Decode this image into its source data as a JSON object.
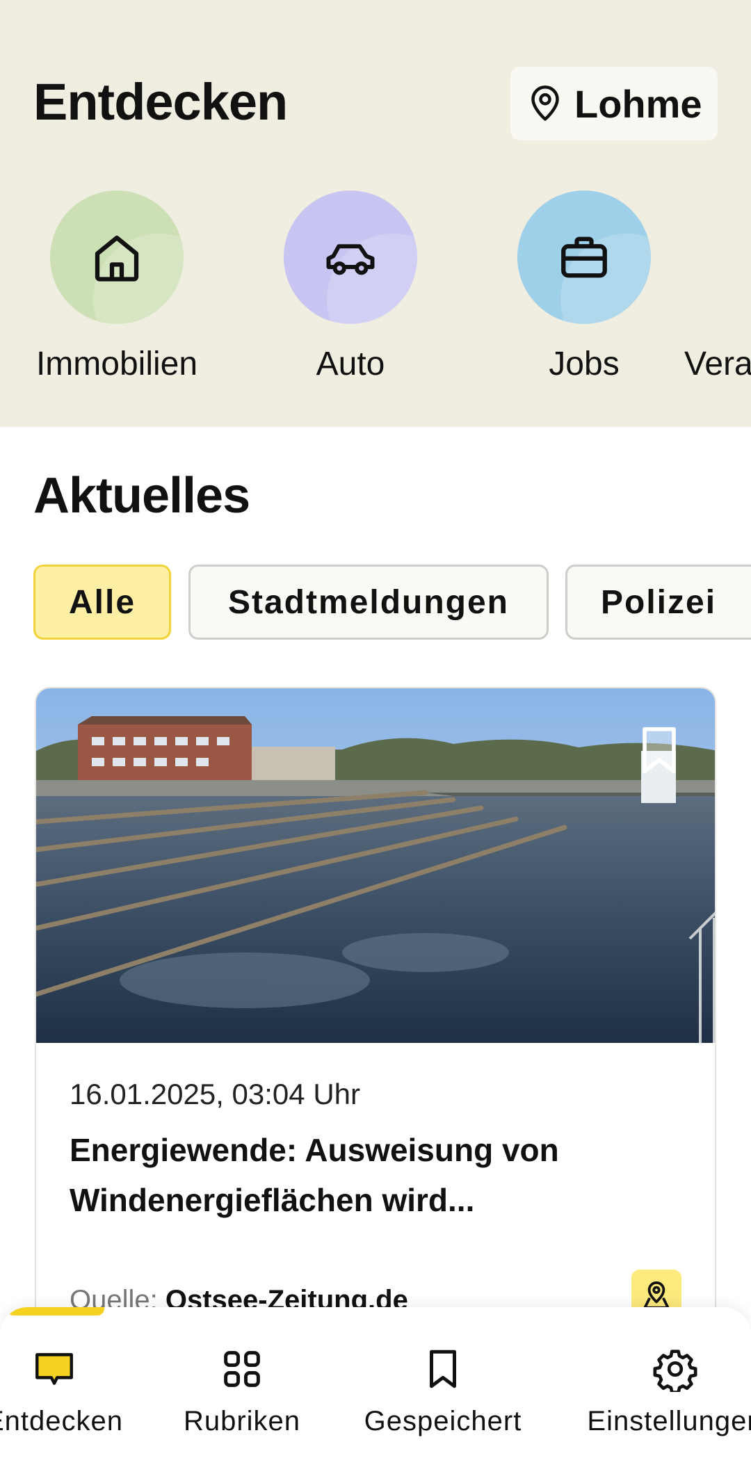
{
  "header": {
    "title": "Entdecken",
    "location_label": "Lohme"
  },
  "categories": [
    {
      "label": "Immobilien",
      "icon": "house-icon",
      "color": "#cde0b5"
    },
    {
      "label": "Auto",
      "icon": "car-icon",
      "color": "#c8c5f2"
    },
    {
      "label": "Jobs",
      "icon": "briefcase-icon",
      "color": "#9fd0ea"
    },
    {
      "label": "Vera",
      "icon": "",
      "color": ""
    }
  ],
  "news": {
    "section_title": "Aktuelles",
    "filters": [
      {
        "label": "Alle",
        "active": true
      },
      {
        "label": "Stadtmeldungen",
        "active": false
      },
      {
        "label": "Polizei",
        "active": false
      }
    ],
    "articles": [
      {
        "date": "16.01.2025, 03:04 Uhr",
        "headline": "Energiewende: Ausweisung von Windenergieflächen wird...",
        "source_prefix": "Quelle:",
        "source_name": "Ostsee-Zeitung.de",
        "image_icon": "water-treatment-basin-photo",
        "bookmark_icon": "bookmark-icon",
        "map_icon": "map-pin-icon"
      }
    ]
  },
  "bottom_nav": [
    {
      "label": "Entdecken",
      "icon": "chat-bubble-icon",
      "active": true
    },
    {
      "label": "Rubriken",
      "icon": "grid-icon",
      "active": false
    },
    {
      "label": "Gespeichert",
      "icon": "bookmark-icon",
      "active": false
    },
    {
      "label": "Einstellungen",
      "icon": "gear-icon",
      "active": false
    }
  ],
  "colors": {
    "header_bg": "#f0ede1",
    "accent_yellow": "#f5d21f",
    "chip_active_bg": "#fdf0a4"
  }
}
